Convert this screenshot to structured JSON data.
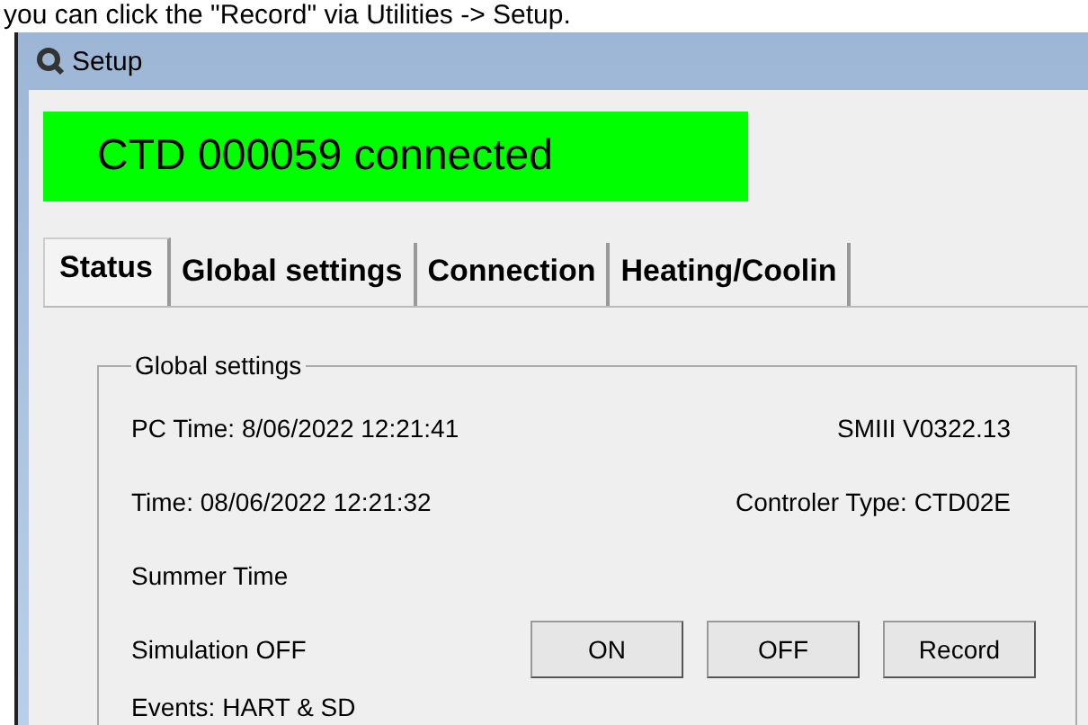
{
  "caption": "you can click the \"Record\" via Utilities -> Setup.",
  "window": {
    "title": "Setup"
  },
  "status_banner": {
    "text": "CTD 000059 connected",
    "color": "#00ff00"
  },
  "tabs": [
    {
      "label": "Status",
      "selected": true
    },
    {
      "label": "Global settings",
      "selected": false
    },
    {
      "label": "Connection",
      "selected": false
    },
    {
      "label": "Heating/Coolin",
      "selected": false
    }
  ],
  "group": {
    "title": "Global settings",
    "rows": [
      {
        "left": "PC Time: 8/06/2022  12:21:41",
        "right": "SMIII V0322.13"
      },
      {
        "left": "Time: 08/06/2022  12:21:32",
        "right": "Controler Type: CTD02E"
      },
      {
        "left": "Summer Time"
      },
      {
        "left": "Simulation OFF",
        "buttons": [
          "ON",
          "OFF",
          "Record"
        ]
      },
      {
        "left": "Events:  HART & SD"
      }
    ]
  }
}
